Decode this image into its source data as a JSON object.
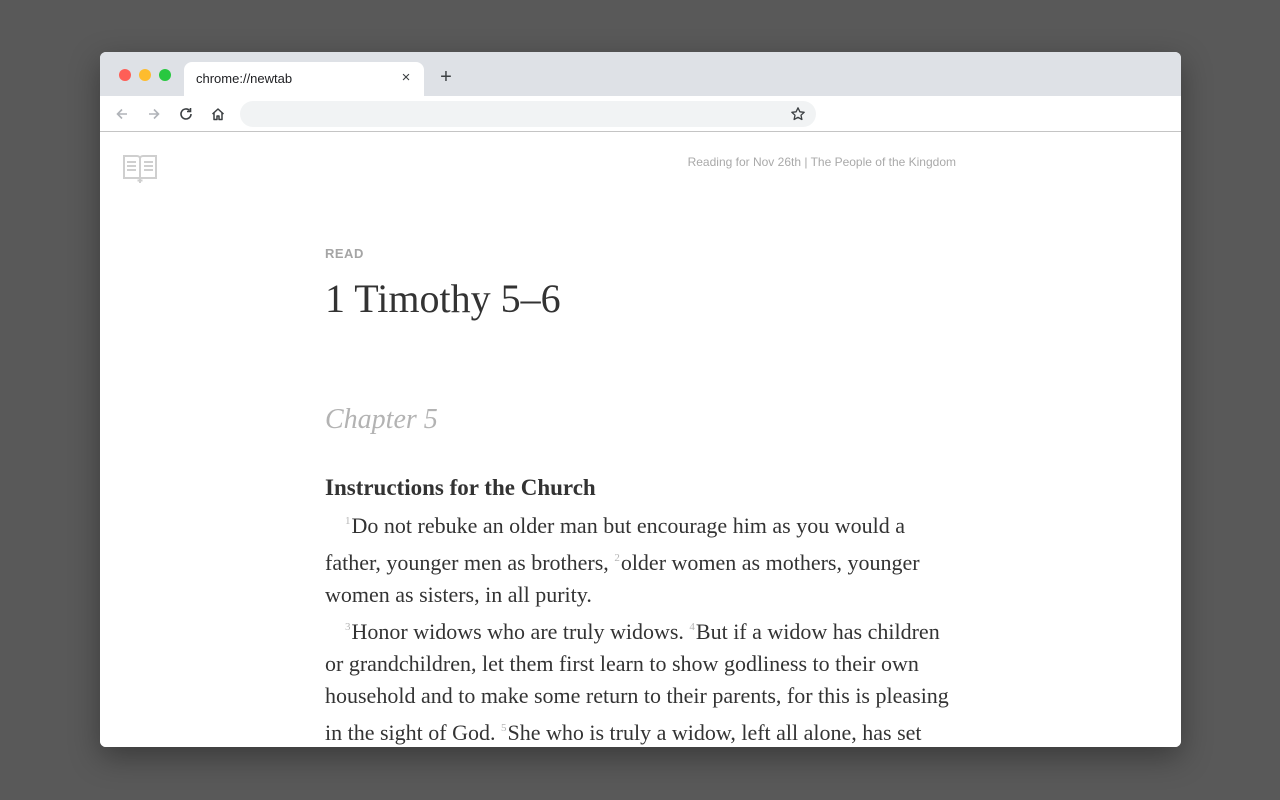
{
  "browser": {
    "tab_title": "chrome://newtab",
    "tab_close": "×",
    "new_tab": "+",
    "address": ""
  },
  "header": {
    "reading_info": "Reading for Nov 26th | The People of the Kingdom"
  },
  "reading": {
    "label": "READ",
    "passage": "1 Timothy 5–6",
    "chapter": "Chapter 5",
    "section_heading": "Instructions for the Church",
    "paragraphs": [
      [
        {
          "n": "1",
          "text": "Do not rebuke an older man but encourage him as you would a father, younger men as brothers, "
        },
        {
          "n": "2",
          "text": "older women as mothers, younger women as sisters, in all purity."
        }
      ],
      [
        {
          "n": "3",
          "text": "Honor widows who are truly widows. "
        },
        {
          "n": "4",
          "text": "But if a widow has children or grandchildren, let them first learn to show godliness to their own household and to make some return to their parents, for this is pleasing in the sight of God. "
        },
        {
          "n": "5",
          "text": "She who is truly a widow, left all alone, has set her hope on God and continues in supplications"
        }
      ]
    ]
  }
}
